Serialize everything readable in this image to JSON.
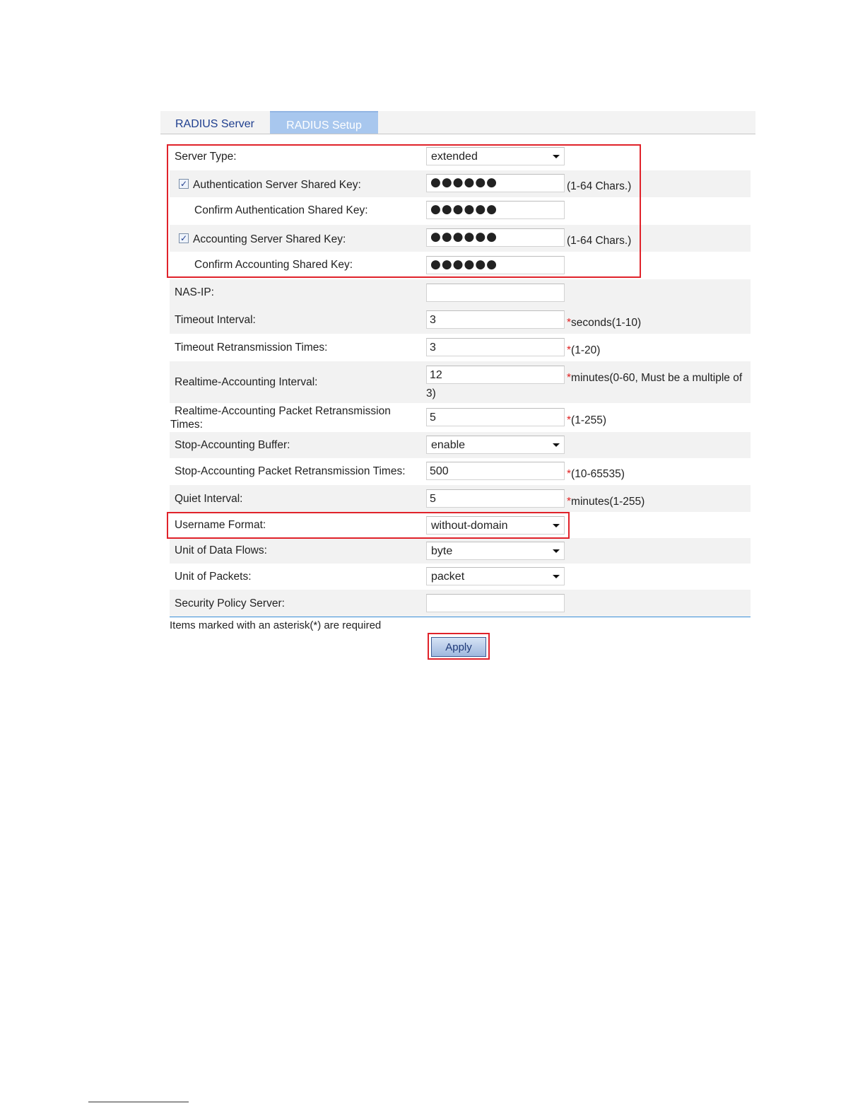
{
  "tabs": [
    {
      "label": "RADIUS Server",
      "active": false
    },
    {
      "label": "RADIUS Setup",
      "active": true
    }
  ],
  "form": {
    "server_type": {
      "label": "Server Type:",
      "value": "extended"
    },
    "auth_key": {
      "label": "Authentication Server Shared Key:",
      "checked": true,
      "value": "●●●●●●",
      "hint": "(1-64 Chars.)"
    },
    "confirm_auth_key": {
      "label": "Confirm Authentication Shared Key:",
      "value": "●●●●●●"
    },
    "acct_key": {
      "label": "Accounting Server Shared Key:",
      "checked": true,
      "value": "●●●●●●",
      "hint": "(1-64 Chars.)"
    },
    "confirm_acct_key": {
      "label": "Confirm Accounting Shared Key:",
      "value": "●●●●●●"
    },
    "nas_ip": {
      "label": "NAS-IP:",
      "value": ""
    },
    "timeout_interval": {
      "label": "Timeout Interval:",
      "value": "3",
      "star": "*",
      "hint": "seconds(1-10)"
    },
    "timeout_retrans": {
      "label": "Timeout Retransmission Times:",
      "value": "3",
      "star": "*",
      "hint": "(1-20)"
    },
    "realtime_interval": {
      "label": "Realtime-Accounting Interval:",
      "value": "12",
      "star": "*",
      "hint": "minutes(0-60, Must be a multiple of",
      "hint2": "3)"
    },
    "realtime_retrans": {
      "label": "Realtime-Accounting Packet Retransmission",
      "label2": "Times:",
      "value": "5",
      "star": "*",
      "hint": "(1-255)"
    },
    "stop_buffer": {
      "label": "Stop-Accounting Buffer:",
      "value": "enable"
    },
    "stop_retrans": {
      "label": "Stop-Accounting Packet Retransmission Times:",
      "value": "500",
      "star": "*",
      "hint": "(10-65535)"
    },
    "quiet_interval": {
      "label": "Quiet Interval:",
      "value": "5",
      "star": "*",
      "hint": "minutes(1-255)"
    },
    "username_format": {
      "label": "Username Format:",
      "value": "without-domain"
    },
    "unit_data_flows": {
      "label": "Unit of Data Flows:",
      "value": "byte"
    },
    "unit_packets": {
      "label": "Unit of Packets:",
      "value": "packet"
    },
    "security_policy_server": {
      "label": "Security Policy Server:",
      "value": ""
    }
  },
  "note": "Items marked with an asterisk(*) are required",
  "apply_label": "Apply",
  "colors": {
    "highlight_border": "#e0222a",
    "active_tab": "#a8c7ee",
    "row_shade": "#f2f2f2"
  }
}
